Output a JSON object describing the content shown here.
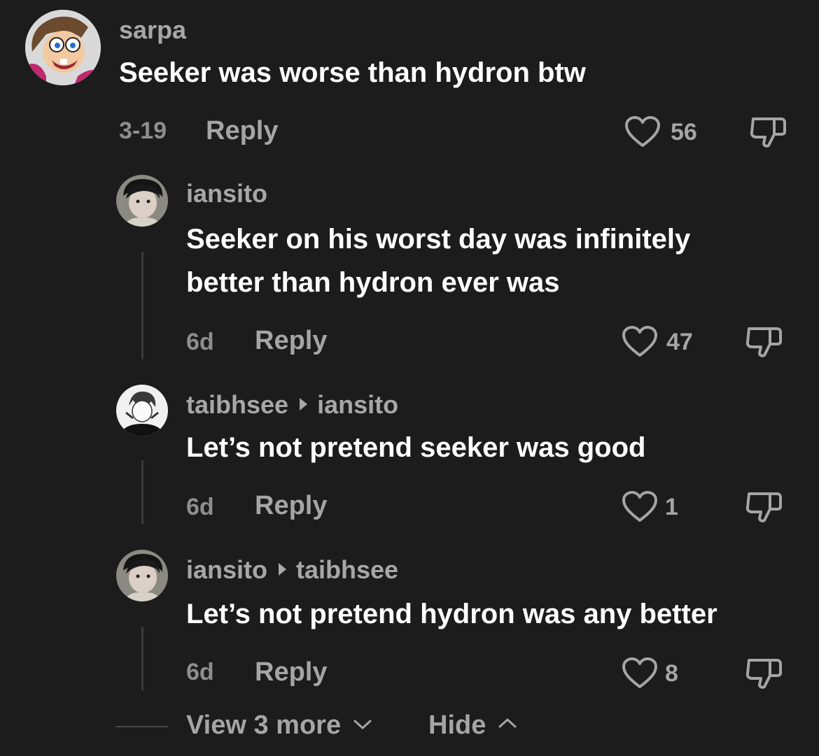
{
  "comments": [
    {
      "username": "sarpa",
      "reply_to": "",
      "text_lines": [
        "Seeker was worse than hydron btw"
      ],
      "time": "3-19",
      "reply_label": "Reply",
      "likes": "56",
      "avatar": "cartoon-character-avatar"
    },
    {
      "username": "iansito",
      "reply_to": "",
      "text_lines": [
        "Seeker on his worst day was infinitely",
        "better than hydron ever was"
      ],
      "time": "6d",
      "reply_label": "Reply",
      "likes": "47",
      "avatar": "photo-avatar"
    },
    {
      "username": "taibhsee",
      "reply_to": "iansito",
      "text_lines": [
        "Let’s not pretend seeker was good"
      ],
      "time": "6d",
      "reply_label": "Reply",
      "likes": "1",
      "avatar": "sketch-avatar"
    },
    {
      "username": "iansito",
      "reply_to": "taibhsee",
      "text_lines": [
        "Let’s not pretend hydron was any better"
      ],
      "time": "6d",
      "reply_label": "Reply",
      "likes": "8",
      "avatar": "photo-avatar"
    }
  ],
  "footer": {
    "view_more_label": "View 3 more",
    "hide_label": "Hide"
  },
  "colors": {
    "background": "#1c1c1c",
    "text": "#ffffff",
    "secondary_text": "#a7a7a7"
  }
}
